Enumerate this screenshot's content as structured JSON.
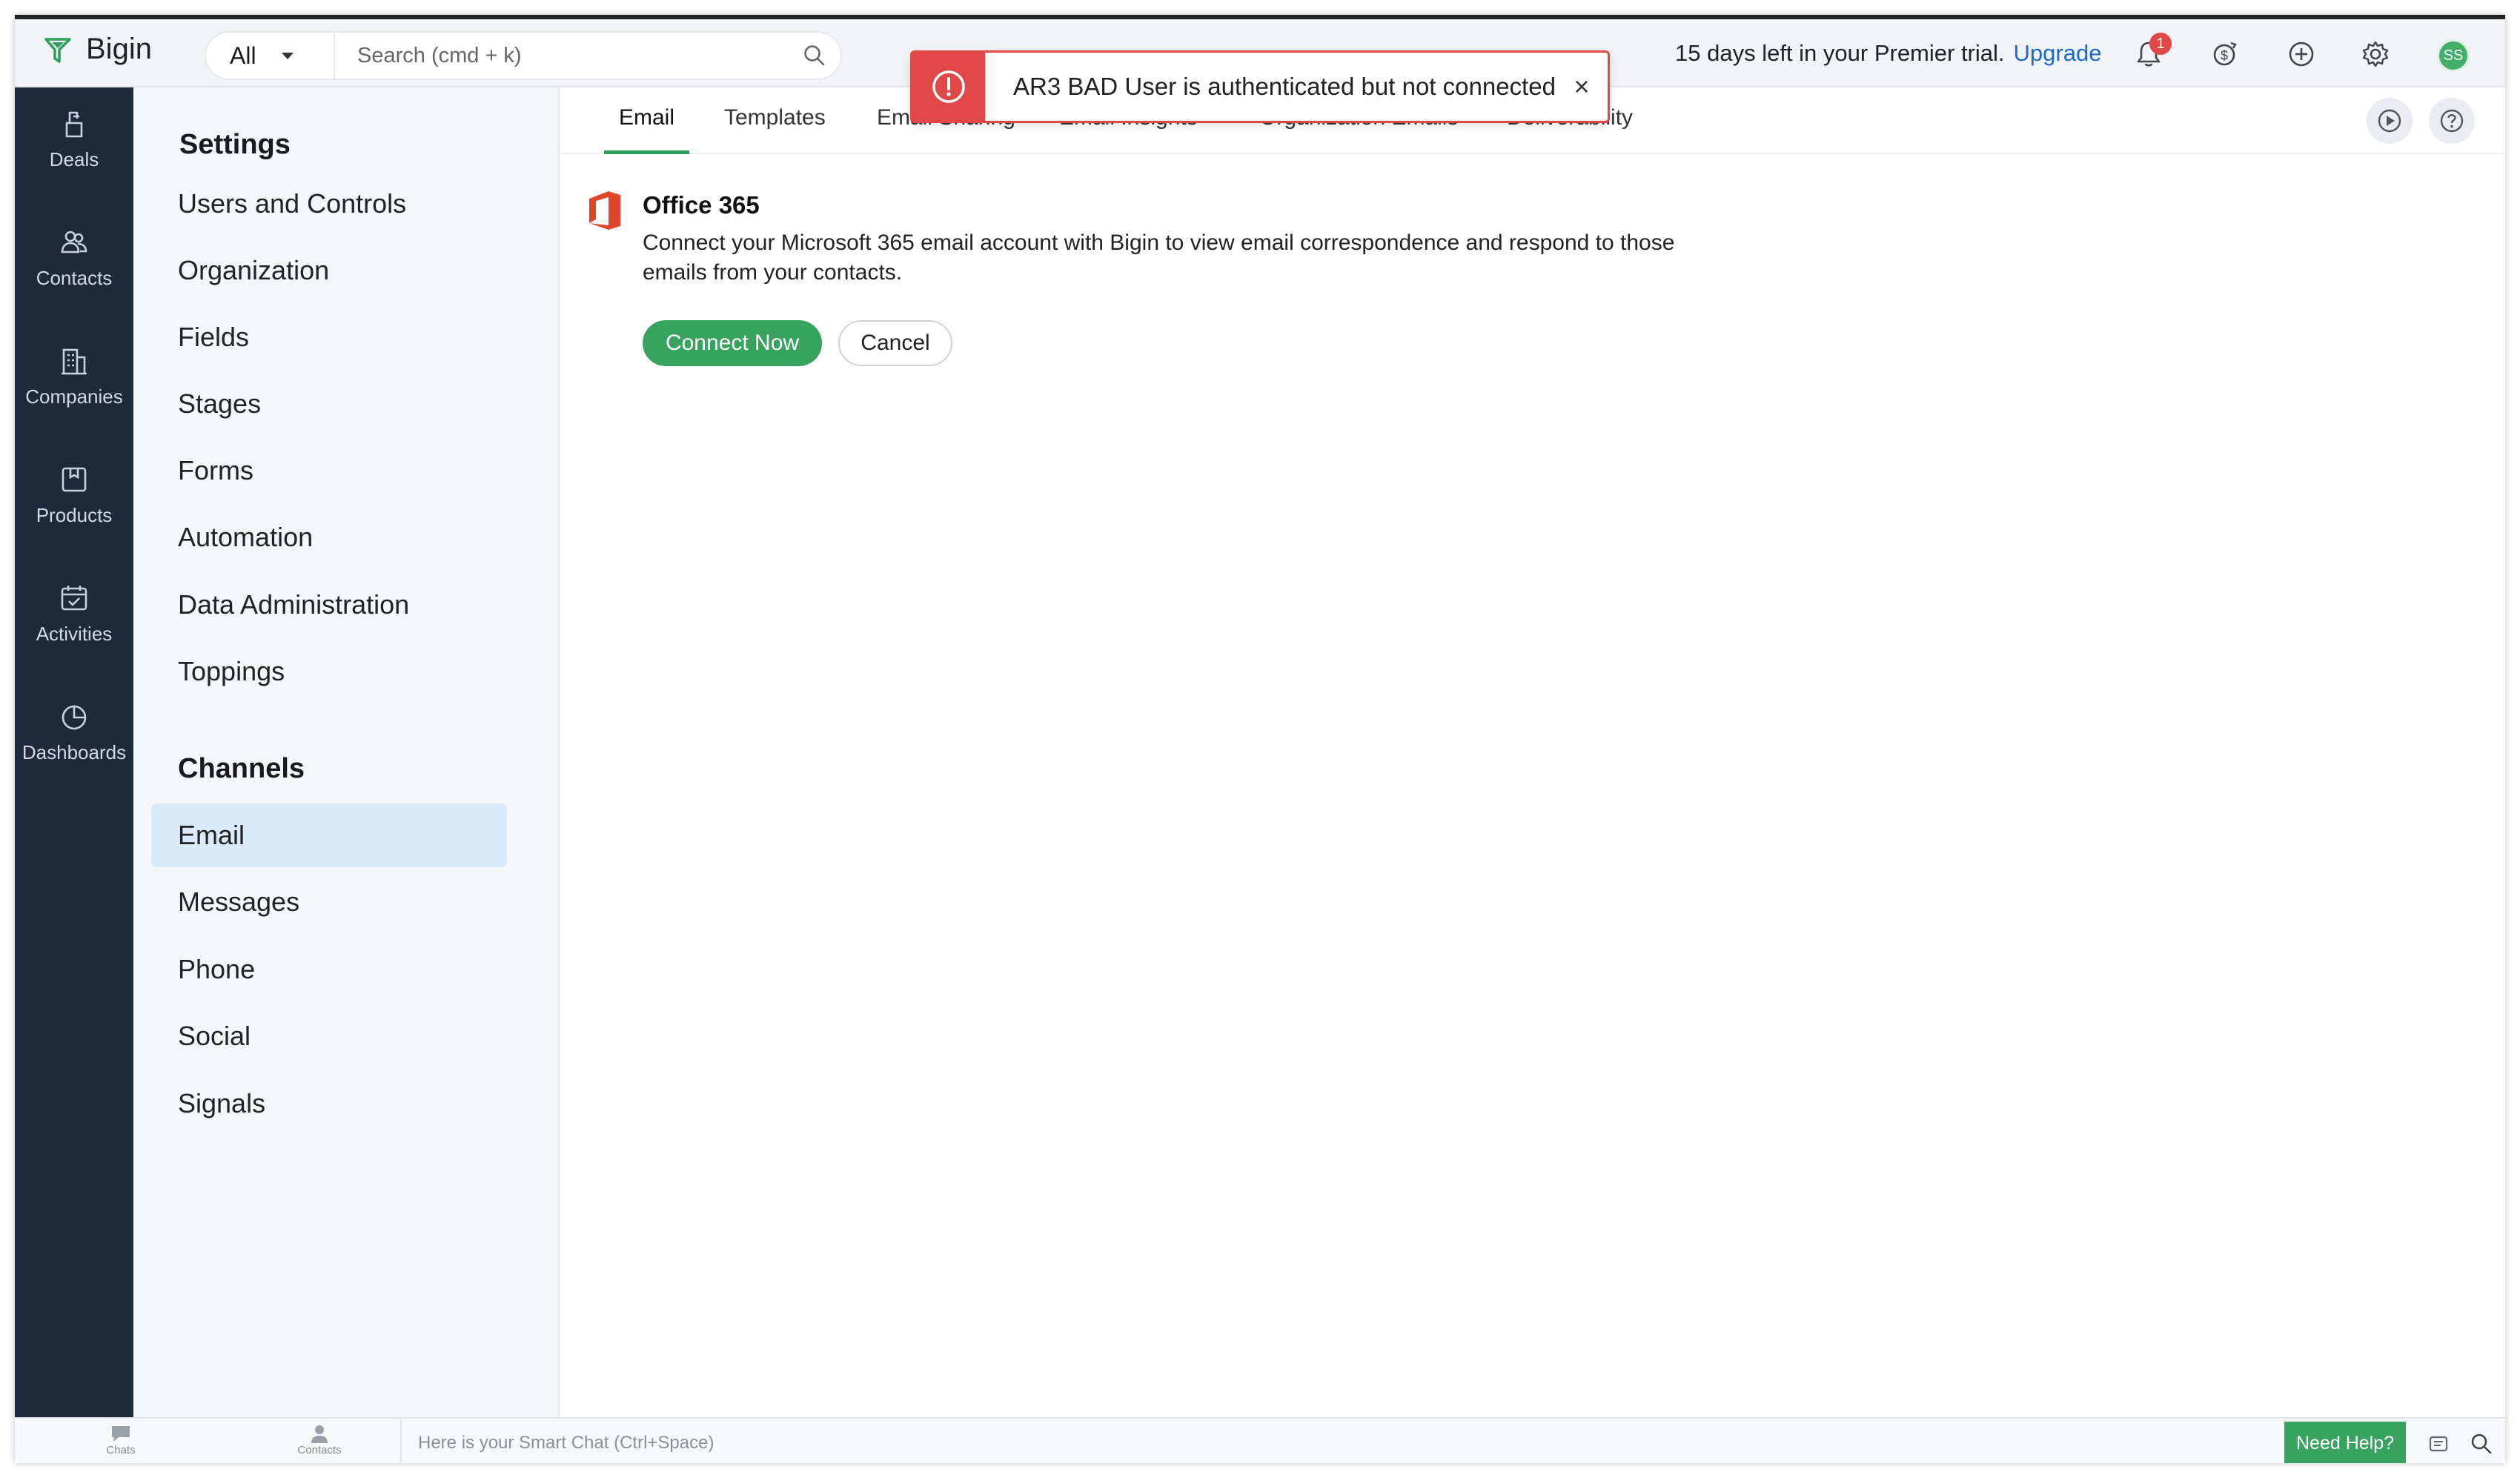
{
  "app": {
    "name": "Bigin"
  },
  "header": {
    "scope": "All",
    "search_placeholder": "Search (cmd + k)",
    "trial_text": "15 days left in your Premier trial.",
    "upgrade_label": "Upgrade",
    "notification_count": "1",
    "avatar_initials": "SS"
  },
  "toast": {
    "message": "AR3 BAD User is authenticated but not connected",
    "close": "×"
  },
  "nav": {
    "items": [
      {
        "label": "Deals",
        "icon": "deals-icon"
      },
      {
        "label": "Contacts",
        "icon": "contacts-icon"
      },
      {
        "label": "Companies",
        "icon": "companies-icon"
      },
      {
        "label": "Products",
        "icon": "products-icon"
      },
      {
        "label": "Activities",
        "icon": "activities-icon"
      },
      {
        "label": "Dashboards",
        "icon": "dashboards-icon"
      }
    ]
  },
  "settings": {
    "title": "Settings",
    "items": [
      "Users and Controls",
      "Organization",
      "Fields",
      "Stages",
      "Forms",
      "Automation",
      "Data Administration",
      "Toppings"
    ],
    "channels_title": "Channels",
    "channel_items": [
      "Email",
      "Messages",
      "Phone",
      "Social",
      "Signals"
    ],
    "active_channel": "Email"
  },
  "tabs": [
    "Email",
    "Templates",
    "Email Sharing",
    "Email Insights",
    "Organization Emails",
    "Deliverability"
  ],
  "active_tab": "Email",
  "provider": {
    "name": "Office 365",
    "description": "Connect your Microsoft 365 email account with Bigin to view email correspondence and respond to those emails from your contacts.",
    "connect_label": "Connect Now",
    "cancel_label": "Cancel"
  },
  "bottom": {
    "chats_label": "Chats",
    "contacts_label": "Contacts",
    "smartchat_placeholder": "Here is your Smart Chat (Ctrl+Space)",
    "help_label": "Need Help?"
  },
  "colors": {
    "accent_green": "#37a35f",
    "error_red": "#e04848",
    "nav_bg": "#1d2a3b",
    "link_blue": "#1b6ac9"
  }
}
